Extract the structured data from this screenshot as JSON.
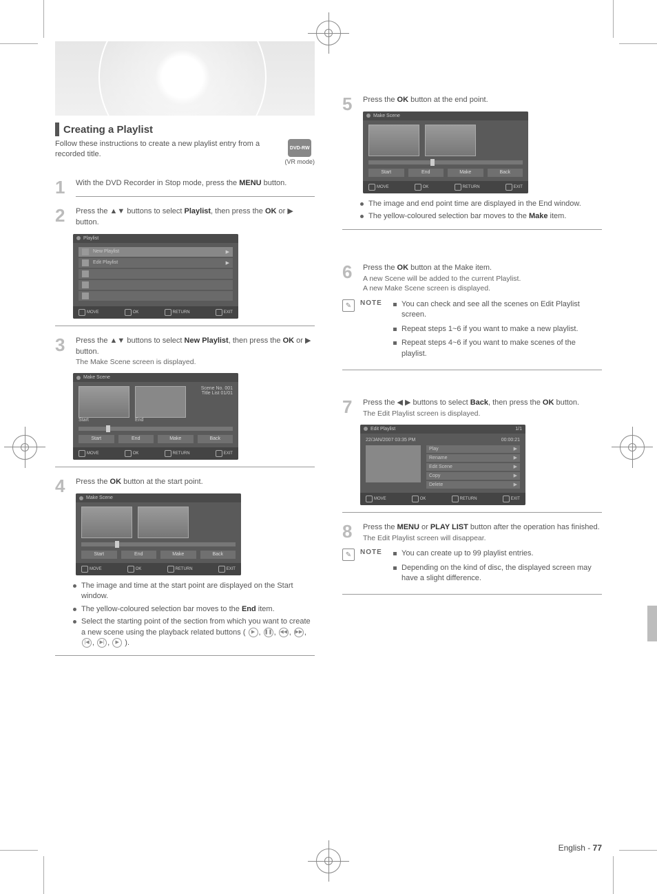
{
  "header": {
    "section_title": "Creating a Playlist",
    "intro": "Follow these instructions to create a new playlist entry from a recorded title.",
    "vr_mode": "(VR mode)",
    "vr_icon_label": "DVD-RW"
  },
  "steps": {
    "s1": {
      "num": "1",
      "text_a": "With the DVD Recorder in Stop mode, press the ",
      "menu": "MENU",
      "text_b": " button."
    },
    "s2": {
      "num": "2",
      "text_a": "Press the ▲▼ buttons to select ",
      "item": "Playlist",
      "text_b": ", then press the ",
      "ok": "OK",
      "text_c": " or ▶ button."
    },
    "s3": {
      "num": "3",
      "text_a": "Press the ▲▼ buttons to select ",
      "item": "New Playlist",
      "text_b": ", then press the ",
      "ok": "OK",
      "text_c": " or ▶ button.",
      "sub": "The Make Scene screen is displayed."
    },
    "s4": {
      "num": "4",
      "text_a": "Press the ",
      "ok": "OK",
      "text_b": " button at the start point."
    },
    "s5": {
      "num": "5",
      "text_a": "Press the ",
      "ok": "OK",
      "text_b": " button at the end point."
    },
    "s6": {
      "num": "6",
      "text_a": "Press the ",
      "ok": "OK",
      "text_b": " button at the Make item.",
      "sub1": "A new Scene will be added to the current Playlist.",
      "sub2": "A new Make Scene screen is displayed."
    },
    "s7": {
      "num": "7",
      "text_a": "Press the ◀ ▶ buttons to select ",
      "item": "Back",
      "text_b": ", then press the ",
      "ok": "OK",
      "text_c": " button.",
      "sub": "The Edit Playlist screen is displayed."
    },
    "s8": {
      "num": "8",
      "text_a": "Press the ",
      "menu": "MENU",
      "text_b": " or ",
      "plist": "PLAY LIST",
      "text_c": " button after the operation has finished.",
      "sub": "The Edit Playlist screen will disappear."
    }
  },
  "bullets4": {
    "b1": "The image and time at the start point are displayed on the Start window.",
    "b2_a": "The yellow-coloured selection bar moves to the ",
    "b2_item": "End",
    "b2_b": " item.",
    "b3": "Select the starting point of the section from which you want to create a new scene using the playback related buttons ("
  },
  "bullets5": {
    "b1": "The image and end point time are displayed in the End window.",
    "b2_a": "The yellow-coloured selection bar moves to the ",
    "b2_item": "Make",
    "b2_b": " item."
  },
  "note6": {
    "label": "NOTE",
    "n1": "You can check and see all the scenes on Edit Playlist screen.",
    "n2": "Repeat steps 1~6 if you want to make a new playlist.",
    "n3": "Repeat steps 4~6 if you want to make scenes of the playlist."
  },
  "note8": {
    "label": "NOTE",
    "n1": "You can create up to 99 playlist entries.",
    "n2": "Depending on the kind of disc, the displayed screen may have a slight difference."
  },
  "ui": {
    "menu": {
      "title": "Playlist",
      "items": [
        "New Playlist",
        "Edit Playlist"
      ]
    },
    "makescene": {
      "title": "Make Scene",
      "labels": [
        "Start",
        "End"
      ],
      "scene_no": "Scene No. 001",
      "tl_title": "Title List  01/01",
      "btns": [
        "Start",
        "End",
        "Make",
        "Back"
      ]
    },
    "editplaylist": {
      "title": "Edit Playlist",
      "date": "22/JAN/2007 03:35 PM",
      "len": "00:00:21",
      "menu": [
        "Play",
        "Rename",
        "Edit Scene",
        "Copy",
        "Delete"
      ],
      "count": "1/1"
    },
    "footer": {
      "move": "MOVE",
      "ok": "OK",
      "return": "RETURN",
      "exit": "EXIT"
    }
  },
  "footer": {
    "lang": "English -",
    "page": "77"
  }
}
